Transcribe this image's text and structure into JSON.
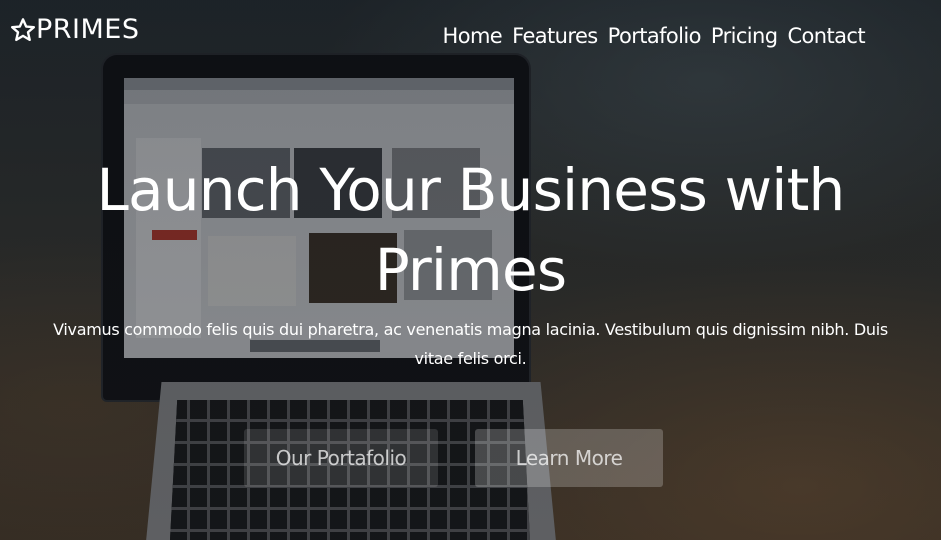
{
  "brand": {
    "name": "PRIMES",
    "icon": "star-icon"
  },
  "nav": {
    "links": [
      "Home",
      "Features",
      "Portafolio",
      "Pricing",
      "Contact"
    ]
  },
  "hero": {
    "title": "Launch Your Business with Primes",
    "text": "Vivamus commodo felis quis dui pharetra, ac venenatis magna lacinia. Vestibulum quis dignissim nibh. Duis vitae felis orci.",
    "buttons": {
      "portfolio": "Our Portafolio",
      "learn_more": "Learn More"
    }
  },
  "colors": {
    "text": "#ffffff",
    "overlay": "#141820"
  }
}
